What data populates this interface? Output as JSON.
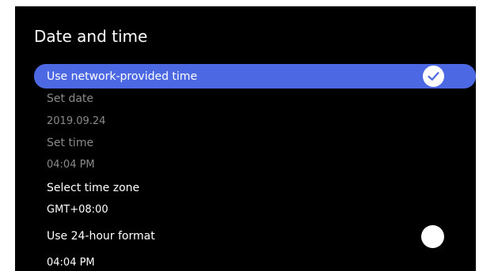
{
  "page": {
    "title": "Date and time"
  },
  "items": [
    {
      "label": "Use network-provided time",
      "state": "checked"
    },
    {
      "label": "Set date"
    },
    {
      "label": "2019.09.24"
    },
    {
      "label": "Set time"
    },
    {
      "label": "04:04 PM"
    },
    {
      "label": "Select time zone"
    },
    {
      "label": "GMT+08:00"
    },
    {
      "label": "Use 24-hour format",
      "state": "off"
    },
    {
      "label": "04:04 PM"
    }
  ],
  "colors": {
    "background": "#000000",
    "selection": "#4d68e3",
    "text": "#ffffff",
    "disabled_text": "#8a8a8a"
  },
  "icons": {
    "checked": "check-circle-icon",
    "toggle_off": "toggle-circle-icon"
  }
}
